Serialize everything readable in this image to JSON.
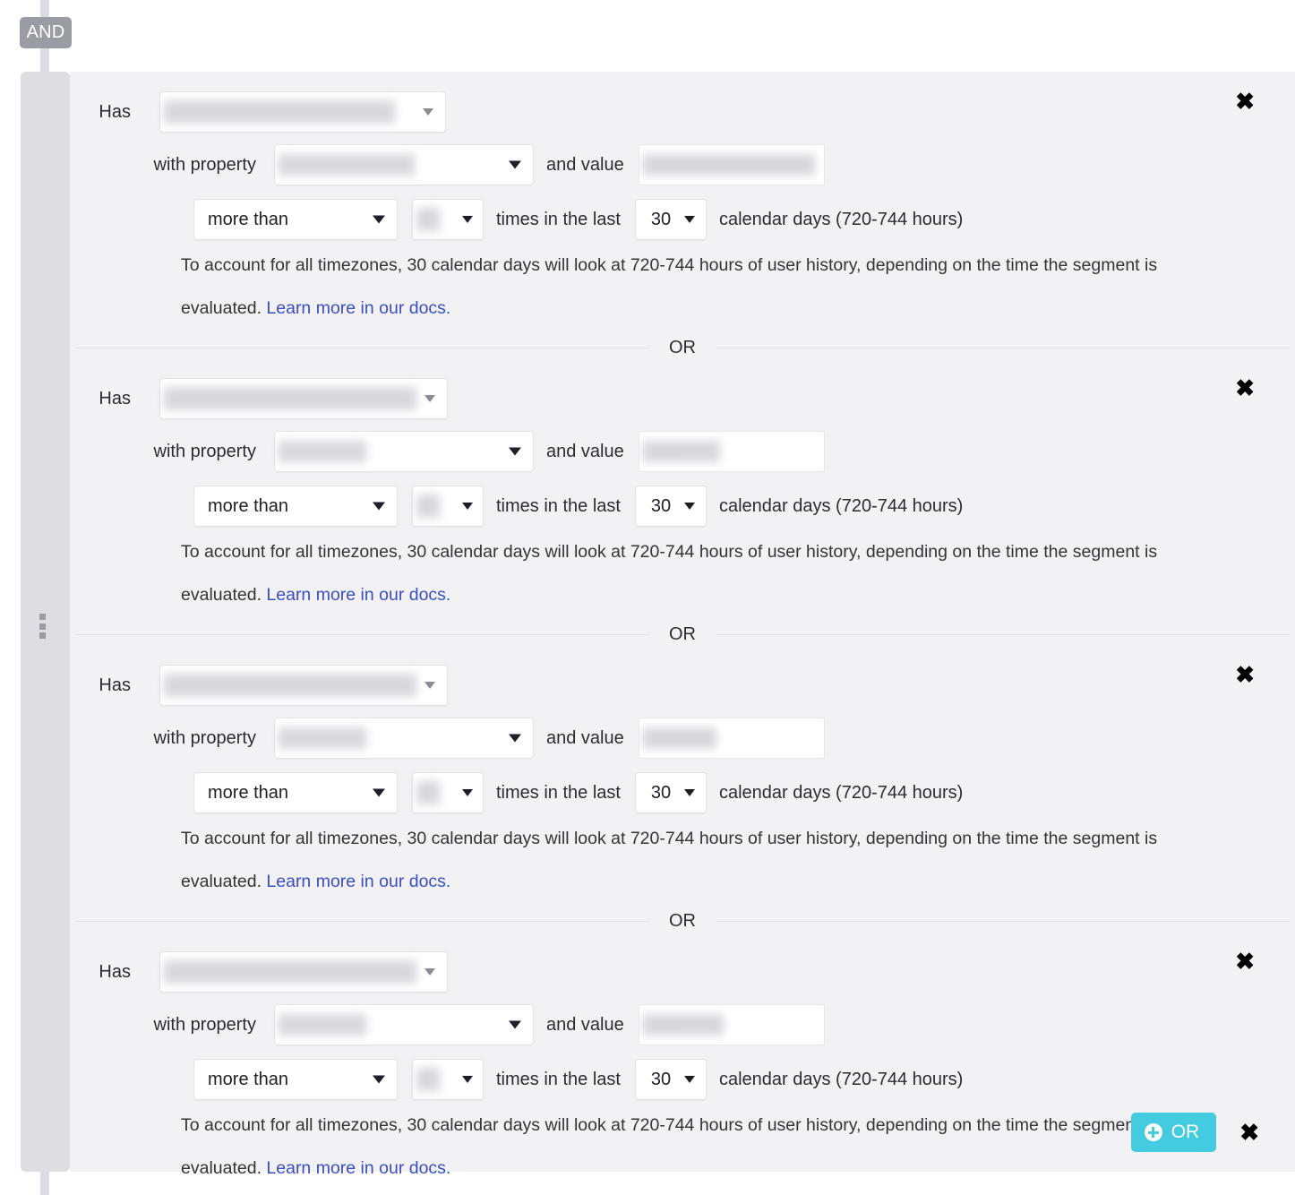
{
  "group": {
    "operator_badge": "AND",
    "drag_handle_icon": "drag-dots-icon",
    "accent_color": "#44cbe0",
    "badge_color": "#9b9ba3",
    "rail_color": "#dddde2",
    "panel_color": "#f2f2f5"
  },
  "labels": {
    "has": "Has",
    "with_property": "with property",
    "and_value": "and value",
    "times_in_the_last": "times in the last",
    "calendar_days": "calendar days (720-744 hours)",
    "or_divider": "OR",
    "close_icon": "close-icon"
  },
  "helper": {
    "text": "To account for all timezones, 30 calendar days will look at 720-744 hours of user history, depending on the time the segment is evaluated. ",
    "link": "Learn more in our docs."
  },
  "footer": {
    "add_or_label": "OR",
    "add_or_icon": "plus-circle-icon",
    "remove_icon": "close-icon"
  },
  "conditions": [
    {
      "event": "",
      "event_redacted": true,
      "event_blur_width": 258,
      "property": "",
      "property_redacted": true,
      "property_blur_width": 152,
      "value": "",
      "value_redacted": true,
      "value_blur_width": 192,
      "operator": "more than",
      "count": "",
      "count_redacted": true,
      "days": "30"
    },
    {
      "event": "",
      "event_redacted": true,
      "event_blur_width": 282,
      "property": "",
      "property_redacted": true,
      "property_blur_width": 98,
      "value": "",
      "value_redacted": true,
      "value_blur_width": 86,
      "operator": "more than",
      "count": "",
      "count_redacted": true,
      "days": "30"
    },
    {
      "event": "",
      "event_redacted": true,
      "event_blur_width": 282,
      "property": "",
      "property_redacted": true,
      "property_blur_width": 98,
      "value": "",
      "value_redacted": true,
      "value_blur_width": 82,
      "operator": "more than",
      "count": "",
      "count_redacted": true,
      "days": "30"
    },
    {
      "event": "",
      "event_redacted": true,
      "event_blur_width": 282,
      "property": "",
      "property_redacted": true,
      "property_blur_width": 98,
      "value": "",
      "value_redacted": true,
      "value_blur_width": 90,
      "operator": "more than",
      "count": "",
      "count_redacted": true,
      "days": "30"
    }
  ]
}
